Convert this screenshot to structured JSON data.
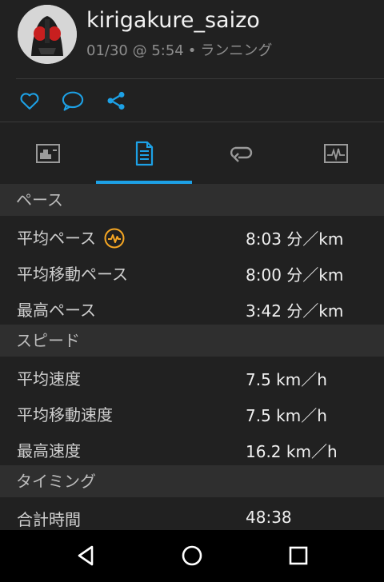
{
  "colors": {
    "accent": "#1da1e6",
    "badge": "#f5a623",
    "background": "#212121",
    "section_bg": "#2f2f2f"
  },
  "header": {
    "avatar_icon": "masked-rider-avatar-icon",
    "user_name": "kirigakure_saizo",
    "date_time": "01/30 @ 5:54",
    "separator": "•",
    "activity_type": "ランニング"
  },
  "actions": [
    {
      "icon": "heart-icon"
    },
    {
      "icon": "comment-icon"
    },
    {
      "icon": "share-icon"
    }
  ],
  "tabs": [
    {
      "icon": "chart-icon",
      "selected": false
    },
    {
      "icon": "stats-list-icon",
      "selected": true
    },
    {
      "icon": "laps-icon",
      "selected": false
    },
    {
      "icon": "heartrate-graph-icon",
      "selected": false
    }
  ],
  "sections": {
    "pace": {
      "title": "ペース",
      "rows": [
        {
          "label": "平均ペース",
          "value": "8:03 分／km",
          "badge": "pace-zone-icon"
        },
        {
          "label": "平均移動ペース",
          "value": "8:00 分／km"
        },
        {
          "label": "最高ペース",
          "value": "3:42 分／km"
        }
      ]
    },
    "speed": {
      "title": "スピード",
      "rows": [
        {
          "label": "平均速度",
          "value": "7.5 km／h"
        },
        {
          "label": "平均移動速度",
          "value": "7.5 km／h"
        },
        {
          "label": "最高速度",
          "value": "16.2 km／h"
        }
      ]
    },
    "timing": {
      "title": "タイミング",
      "rows": [
        {
          "label": "合計時間",
          "value": "48:38"
        }
      ]
    }
  },
  "navbar": [
    {
      "icon": "back-icon"
    },
    {
      "icon": "home-icon"
    },
    {
      "icon": "recents-icon"
    }
  ]
}
